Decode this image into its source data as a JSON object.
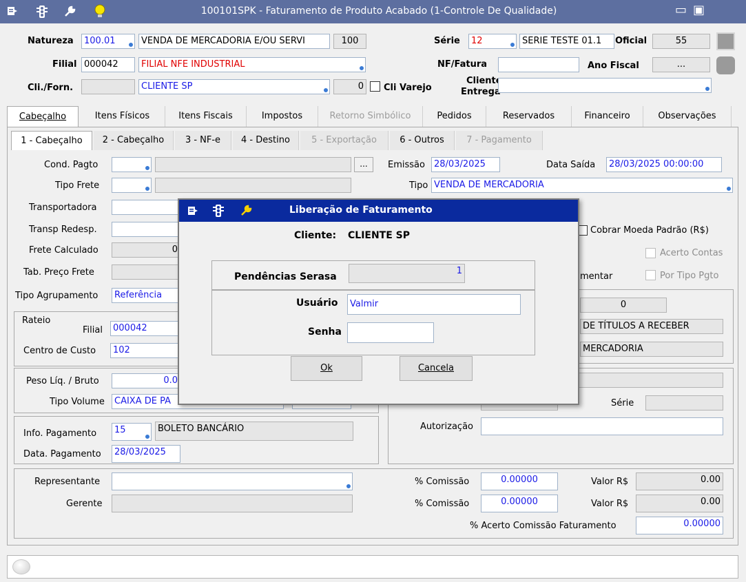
{
  "window": {
    "title": "100101SPK - Faturamento de Produto Acabado (1-Controle De Qualidade)",
    "icons": [
      "form-icon",
      "traffic-light-icon",
      "wrench-icon",
      "lightbulb-icon"
    ],
    "minimize_glyph": "▭",
    "maximize_glyph": "▣"
  },
  "header": {
    "natureza_label": "Natureza",
    "natureza_code": "100.01",
    "natureza_desc": "VENDA DE MERCADORIA E/OU SERVI",
    "natureza_num": "100",
    "serie_label": "Série",
    "serie_code": "12",
    "serie_desc": "SERIE TESTE 01.1",
    "oficial_label": "Oficial",
    "oficial_value": "55",
    "filial_label": "Filial",
    "filial_code": "000042",
    "filial_desc": "FILIAL NFE INDUSTRIAL",
    "nf_label": "NF/Fatura",
    "nf_value": "",
    "ano_label": "Ano Fiscal",
    "ano_value": "...",
    "cli_label": "Cli./Forn.",
    "cli_code": "",
    "cli_desc": "CLIENTE SP",
    "cli_num": "0",
    "cli_varejo_label": "Cli Varejo",
    "cliente_entrega_label_1": "Cliente",
    "cliente_entrega_label_2": "Entrega",
    "cliente_entrega_value": ""
  },
  "tabs": [
    "Cabeçalho",
    "Itens Físicos",
    "Itens Fiscais",
    "Impostos",
    "Retorno Simbólico",
    "Pedidos",
    "Reservados",
    "Financeiro",
    "Observações"
  ],
  "subtabs": [
    "1 - Cabeçalho",
    "2 - Cabeçalho",
    "3 - NF-e",
    "4 - Destino",
    "5 - Exportação",
    "6 - Outros",
    "7 - Pagamento"
  ],
  "form": {
    "cond_pagto_label": "Cond. Pagto",
    "ellipsis": "...",
    "emissao_label": "Emissão",
    "emissao_value": "28/03/2025",
    "data_saida_label": "Data Saída",
    "data_saida_value": "28/03/2025 00:00:00",
    "tipo_frete_label": "Tipo Frete",
    "tipo_label": "Tipo",
    "tipo_value": "VENDA DE MERCADORIA",
    "transportadora_label": "Transportadora",
    "transp_redesp_label": "Transp Redesp.",
    "cobrar_moeda_label": "Cobrar Moeda Padrão (R$)",
    "frete_calculado_label": "Frete Calculado",
    "frete_calculado_value": "0",
    "acerto_contas_label": "Acerto Contas",
    "tab_preco_frete_label": "Tab. Preço Frete",
    "mentar_label": "mentar",
    "por_tipo_pgto_label": "Por Tipo Pgto",
    "tipo_agrupamento_label": "Tipo Agrupamento",
    "tipo_agrupamento_value": "Referência",
    "right_zero": "0",
    "rateio_label": "Rateio",
    "rateio_filial_label": "Filial",
    "rateio_filial_value": "000042",
    "titulos_text": "DE TÍTULOS A RECEBER",
    "centro_custo_label": "Centro de Custo",
    "centro_custo_value": "102",
    "mercadoria_text": "MERCADORIA",
    "peso_label": "Peso Líq. / Bruto",
    "peso_value": "0.0",
    "tipo_volume_label": "Tipo Volume",
    "tipo_volume_value": "CAIXA DE PA",
    "serie_label": "Série",
    "info_pagamento_label": "Info. Pagamento",
    "info_pagamento_code": "15",
    "info_pagamento_desc": "BOLETO BANCÁRIO",
    "autorizacao_label": "Autorização",
    "data_pagamento_label": "Data. Pagamento",
    "data_pagamento_value": "28/03/2025",
    "representante_label": "Representante",
    "gerente_label": "Gerente",
    "comissao_label": "% Comissão",
    "comissao1_value": "0.00000",
    "comissao2_value": "0.00000",
    "valor_label": "Valor R$",
    "valor1_value": "0.00",
    "valor2_value": "0.00",
    "acerto_comissao_label": "% Acerto Comissão Faturamento",
    "acerto_comissao_value": "0.00000"
  },
  "dialog": {
    "title": "Liberação de Faturamento",
    "cliente_label": "Cliente:",
    "cliente_value": "CLIENTE SP",
    "pendencias_label": "Pendências Serasa",
    "pendencias_value": "1",
    "usuario_label": "Usuário",
    "usuario_value": "Valmir",
    "senha_label": "Senha",
    "senha_value": "",
    "ok_label": "Ok",
    "cancela_label": "Cancela"
  },
  "colors": {
    "titlebar": "#5d6fa0",
    "dialog_titlebar": "#0a2a9e",
    "field_text": "#1a1ae6",
    "red_text": "#e00000"
  }
}
